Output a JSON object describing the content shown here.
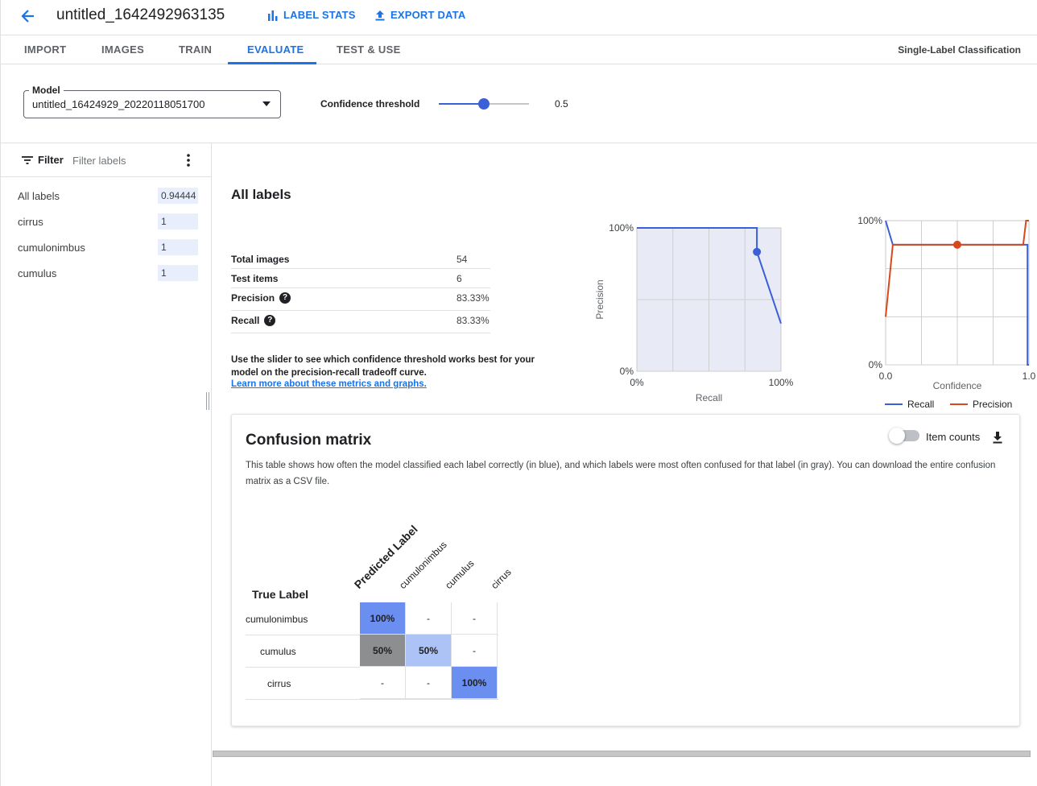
{
  "header": {
    "title": "untitled_1642492963135",
    "label_stats": "LABEL STATS",
    "export_data": "EXPORT DATA"
  },
  "tabs": [
    {
      "label": "IMPORT"
    },
    {
      "label": "IMAGES"
    },
    {
      "label": "TRAIN"
    },
    {
      "label": "EVALUATE",
      "active": true
    },
    {
      "label": "TEST & USE"
    }
  ],
  "model_type": "Single-Label Classification",
  "model": {
    "legend": "Model",
    "value": "untitled_16424929_20220118051700"
  },
  "confidence": {
    "label": "Confidence threshold",
    "value": "0.5",
    "fraction": 0.5
  },
  "filter": {
    "label": "Filter",
    "placeholder": "Filter labels"
  },
  "labels": [
    {
      "name": "All labels",
      "score": "0.94444"
    },
    {
      "name": "cirrus",
      "score": "1"
    },
    {
      "name": "cumulonimbus",
      "score": "1"
    },
    {
      "name": "cumulus",
      "score": "1"
    }
  ],
  "summary": {
    "title": "All labels",
    "rows": [
      {
        "label": "Total images",
        "value": "54"
      },
      {
        "label": "Test items",
        "value": "6"
      },
      {
        "label": "Precision",
        "value": "83.33%",
        "help": true
      },
      {
        "label": "Recall",
        "value": "83.33%",
        "help": true
      }
    ],
    "note": "Use the slider to see which confidence threshold works best for your model on the precision-recall tradeoff curve.",
    "link": "Learn more about these metrics and graphs."
  },
  "colors": {
    "accent": "#1a73e8",
    "recall": "#3b5fd6",
    "precision": "#d9481c",
    "cm_correct": "#6b8ff0",
    "cm_partial": "#adc3f5",
    "cm_confused": "#8d8e90"
  },
  "chart_data": [
    {
      "type": "line",
      "xlabel": "Recall",
      "ylabel": "Precision",
      "x_ticks": [
        "0%",
        "100%"
      ],
      "y_ticks": [
        "0%",
        "100%"
      ],
      "xlim": [
        0,
        1
      ],
      "ylim": [
        0,
        1
      ],
      "grid": true,
      "series": [
        {
          "x": [
            0,
            0.833,
            0.833,
            1.0
          ],
          "y": [
            1.0,
            1.0,
            0.833,
            0.333
          ]
        }
      ],
      "marker": {
        "x": 0.833,
        "y": 0.833
      }
    },
    {
      "type": "line",
      "xlabel": "Confidence",
      "x_ticks": [
        "0.0",
        "1.0"
      ],
      "y_ticks": [
        "0%",
        "100%"
      ],
      "xlim": [
        0,
        1
      ],
      "ylim": [
        0,
        1
      ],
      "grid": true,
      "legend": "bottom",
      "series": [
        {
          "name": "Recall",
          "x": [
            0,
            0.05,
            0.99,
            0.99,
            1.0
          ],
          "y": [
            1.0,
            0.833,
            0.833,
            0.0,
            0.0
          ]
        },
        {
          "name": "Precision",
          "x": [
            0,
            0.05,
            0.96,
            0.98,
            1.0
          ],
          "y": [
            0.333,
            0.833,
            0.833,
            1.0,
            1.0
          ]
        }
      ],
      "marker": {
        "x": 0.5,
        "y": 0.833
      }
    }
  ],
  "confusion": {
    "title": "Confusion matrix",
    "description": "This table shows how often the model classified each label correctly (in blue), and which labels were most often confused for that label (in gray). You can download the entire confusion matrix as a CSV file.",
    "toggle_label": "Item counts",
    "predicted_header": "Predicted Label",
    "true_header": "True Label",
    "columns": [
      "cumulonimbus",
      "cumulus",
      "cirrus"
    ],
    "rows": [
      {
        "label": "cumulonimbus",
        "cells": [
          {
            "v": "100%",
            "kind": "correct"
          },
          {
            "v": "-",
            "kind": "none"
          },
          {
            "v": "-",
            "kind": "none"
          }
        ]
      },
      {
        "label": "cumulus",
        "cells": [
          {
            "v": "50%",
            "kind": "confused"
          },
          {
            "v": "50%",
            "kind": "partial"
          },
          {
            "v": "-",
            "kind": "none"
          }
        ]
      },
      {
        "label": "cirrus",
        "cells": [
          {
            "v": "-",
            "kind": "none"
          },
          {
            "v": "-",
            "kind": "none"
          },
          {
            "v": "100%",
            "kind": "correct"
          }
        ]
      }
    ]
  }
}
